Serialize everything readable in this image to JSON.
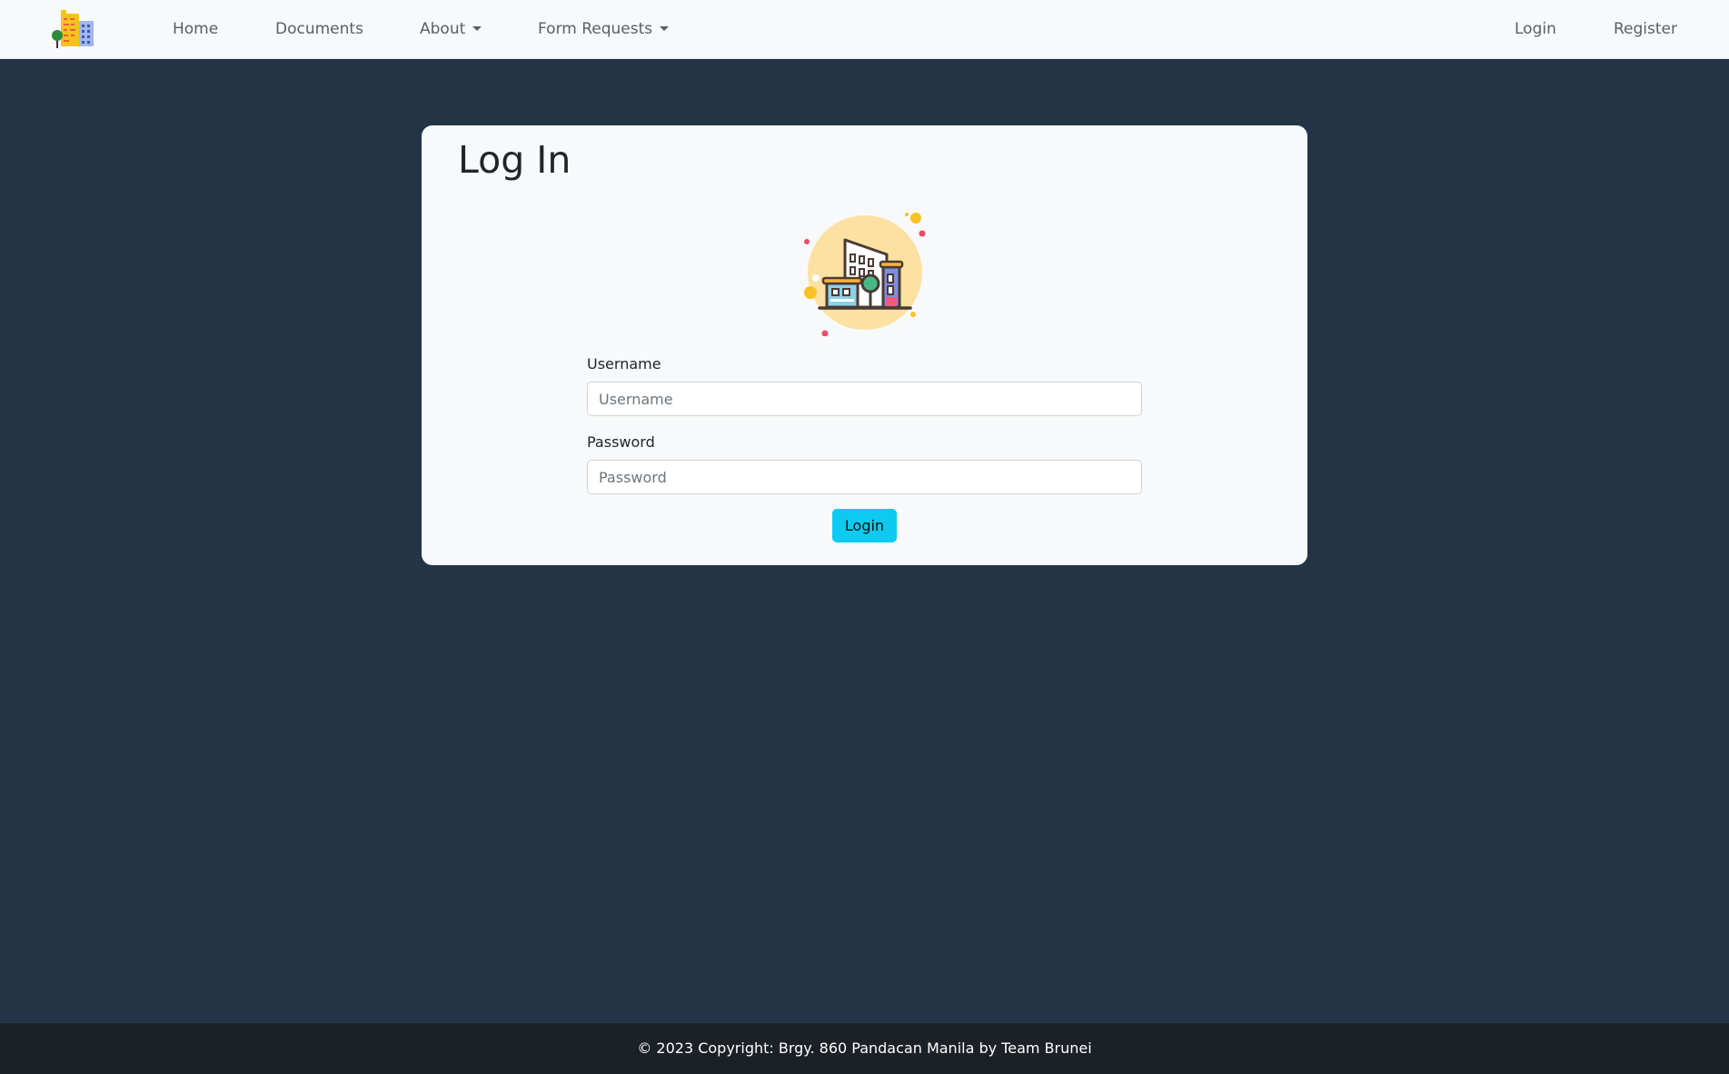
{
  "navbar": {
    "brand_icon": "city-buildings-logo-icon",
    "links": {
      "home": "Home",
      "documents": "Documents",
      "about": "About",
      "form_requests": "Form Requests",
      "login": "Login",
      "register": "Register"
    }
  },
  "login_card": {
    "title": "Log In",
    "illustration_icon": "city-buildings-illustration-icon",
    "username": {
      "label": "Username",
      "placeholder": "Username",
      "value": ""
    },
    "password": {
      "label": "Password",
      "placeholder": "Password",
      "value": ""
    },
    "submit_label": "Login"
  },
  "footer": {
    "text": "© 2023 Copyright: Brgy. 860 Pandacan Manila by Team Brunei"
  },
  "colors": {
    "page_background": "#233447",
    "navbar_background": "#f8f9fa",
    "card_background": "#f8f9fa",
    "button_accent": "#0dcaf0",
    "footer_background": "#1b2126"
  }
}
